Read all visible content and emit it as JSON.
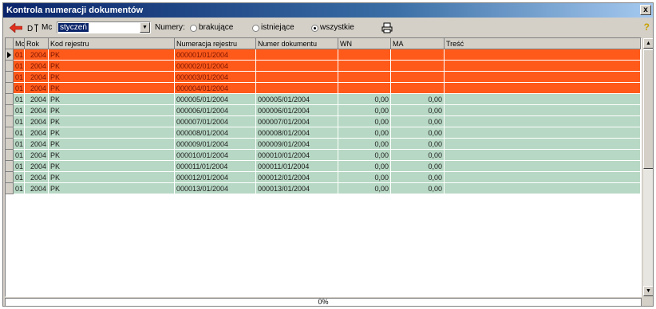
{
  "window": {
    "title": "Kontrola numeracji dokumentów",
    "close_glyph": "x"
  },
  "toolbar": {
    "mc_label": "Mc",
    "mc_value": "styczeń",
    "numery_label": "Numery:",
    "options": [
      {
        "label": "brakujące",
        "checked": false
      },
      {
        "label": "istniejące",
        "checked": false
      },
      {
        "label": "wszystkie",
        "checked": true
      }
    ],
    "help_glyph": "?"
  },
  "grid": {
    "columns": [
      "Mc",
      "Rok",
      "Kod rejestru",
      "Numeracja rejestru",
      "Numer dokumentu",
      "WN",
      "MA",
      "Treść"
    ],
    "rows": [
      {
        "status": "missing",
        "mc": "01",
        "rok": "2004",
        "kod": "PK",
        "numeracja": "000001/01/2004",
        "numer": "",
        "wn": "",
        "ma": "",
        "tresc": ""
      },
      {
        "status": "missing",
        "mc": "01",
        "rok": "2004",
        "kod": "PK",
        "numeracja": "000002/01/2004",
        "numer": "",
        "wn": "",
        "ma": "",
        "tresc": ""
      },
      {
        "status": "missing",
        "mc": "01",
        "rok": "2004",
        "kod": "PK",
        "numeracja": "000003/01/2004",
        "numer": "",
        "wn": "",
        "ma": "",
        "tresc": ""
      },
      {
        "status": "missing",
        "mc": "01",
        "rok": "2004",
        "kod": "PK",
        "numeracja": "000004/01/2004",
        "numer": "",
        "wn": "",
        "ma": "",
        "tresc": ""
      },
      {
        "status": "existing",
        "mc": "01",
        "rok": "2004",
        "kod": "PK",
        "numeracja": "000005/01/2004",
        "numer": "000005/01/2004",
        "wn": "0,00",
        "ma": "0,00",
        "tresc": ""
      },
      {
        "status": "existing",
        "mc": "01",
        "rok": "2004",
        "kod": "PK",
        "numeracja": "000006/01/2004",
        "numer": "000006/01/2004",
        "wn": "0,00",
        "ma": "0,00",
        "tresc": ""
      },
      {
        "status": "existing",
        "mc": "01",
        "rok": "2004",
        "kod": "PK",
        "numeracja": "000007/01/2004",
        "numer": "000007/01/2004",
        "wn": "0,00",
        "ma": "0,00",
        "tresc": ""
      },
      {
        "status": "existing",
        "mc": "01",
        "rok": "2004",
        "kod": "PK",
        "numeracja": "000008/01/2004",
        "numer": "000008/01/2004",
        "wn": "0,00",
        "ma": "0,00",
        "tresc": ""
      },
      {
        "status": "existing",
        "mc": "01",
        "rok": "2004",
        "kod": "PK",
        "numeracja": "000009/01/2004",
        "numer": "000009/01/2004",
        "wn": "0,00",
        "ma": "0,00",
        "tresc": ""
      },
      {
        "status": "existing",
        "mc": "01",
        "rok": "2004",
        "kod": "PK",
        "numeracja": "000010/01/2004",
        "numer": "000010/01/2004",
        "wn": "0,00",
        "ma": "0,00",
        "tresc": ""
      },
      {
        "status": "existing",
        "mc": "01",
        "rok": "2004",
        "kod": "PK",
        "numeracja": "000011/01/2004",
        "numer": "000011/01/2004",
        "wn": "0,00",
        "ma": "0,00",
        "tresc": ""
      },
      {
        "status": "existing",
        "mc": "01",
        "rok": "2004",
        "kod": "PK",
        "numeracja": "000012/01/2004",
        "numer": "000012/01/2004",
        "wn": "0,00",
        "ma": "0,00",
        "tresc": ""
      },
      {
        "status": "existing",
        "mc": "01",
        "rok": "2004",
        "kod": "PK",
        "numeracja": "000013/01/2004",
        "numer": "000013/01/2004",
        "wn": "0,00",
        "ma": "0,00",
        "tresc": ""
      }
    ],
    "selected_row": 0
  },
  "status": {
    "progress_text": "0%"
  },
  "colors": {
    "missing_row": "#ff5a1a",
    "existing_row": "#b7d8c4",
    "titlebar": "#0a246a"
  },
  "icons": [
    "back-arrow-icon",
    "find-icon",
    "print-icon",
    "help-icon",
    "row-pointer-icon"
  ]
}
